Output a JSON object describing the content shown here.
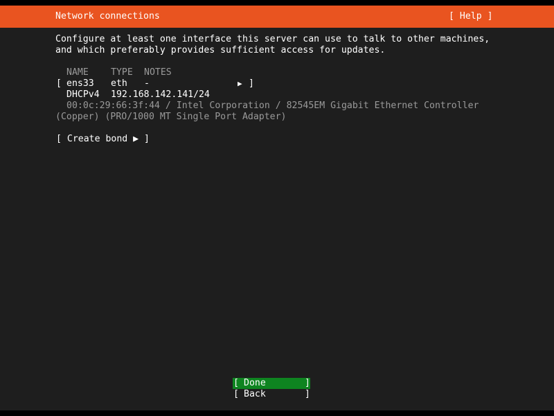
{
  "header": {
    "title": "Network connections",
    "help": "[ Help ]"
  },
  "intro": {
    "line1": "Configure at least one interface this server can use to talk to other machines,",
    "line2": "and which preferably provides sufficient access for updates."
  },
  "table": {
    "columns": [
      "NAME",
      "TYPE",
      "NOTES"
    ],
    "interface": {
      "open_bracket": "[",
      "name": "ens33",
      "type": "eth",
      "notes": "-",
      "arrow": "▶",
      "close_bracket": "]",
      "dhcp_label": "DHCPv4",
      "address": "192.168.142.141/24",
      "hardware_line1": "00:0c:29:66:3f:44 / Intel Corporation / 82545EM Gigabit Ethernet Controller",
      "hardware_line2": "(Copper) (PRO/1000 MT Single Port Adapter)"
    }
  },
  "create_bond": "[ Create bond ▶ ]",
  "buttons": {
    "done": "Done",
    "back": "Back",
    "open_bracket": "[",
    "close_bracket": "]"
  },
  "colors": {
    "header_bg": "#e95420",
    "screen_bg": "#1e1e1e",
    "selected_button_bg": "#0e8420",
    "dim_text": "#9a9a9a"
  }
}
